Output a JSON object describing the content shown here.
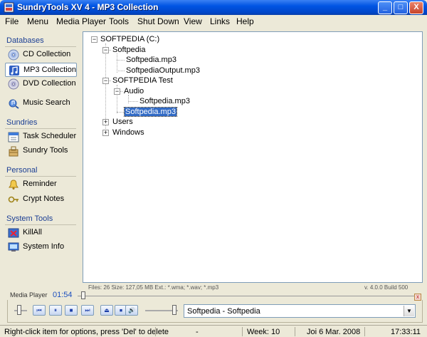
{
  "window": {
    "title": "SundryTools XV 4 - MP3 Collection",
    "minimize_symbol": "_",
    "maximize_symbol": "□",
    "close_symbol": "X"
  },
  "menu": [
    "File",
    "Menu",
    "Media Player",
    "Tools",
    "Shut Down",
    "View",
    "Links",
    "Help"
  ],
  "sidebar": {
    "databases": {
      "title": "Databases",
      "items": [
        {
          "label": "CD Collection",
          "icon": "cd-icon"
        },
        {
          "label": "MP3 Collection",
          "icon": "music-note-icon",
          "active": true
        },
        {
          "label": "DVD Collection",
          "icon": "dvd-icon"
        },
        {
          "label": "Music Search",
          "icon": "music-search-icon"
        }
      ]
    },
    "sundries": {
      "title": "Sundries",
      "items": [
        {
          "label": "Task Scheduler",
          "icon": "calendar-icon"
        },
        {
          "label": "Sundry Tools",
          "icon": "tools-icon"
        }
      ]
    },
    "personal": {
      "title": "Personal",
      "items": [
        {
          "label": "Reminder",
          "icon": "bell-icon"
        },
        {
          "label": "Crypt Notes",
          "icon": "key-icon"
        }
      ]
    },
    "system_tools": {
      "title": "System Tools",
      "items": [
        {
          "label": "KillAll",
          "icon": "killall-icon"
        },
        {
          "label": "System Info",
          "icon": "monitor-icon"
        }
      ]
    }
  },
  "tree": {
    "root": "SOFTPEDIA (C:)",
    "softpedia": "Softpedia",
    "softpedia_mp3": "Softpedia.mp3",
    "softpedia_output": "SoftpediaOutput.mp3",
    "softpedia_test": "SOFTPEDIA Test",
    "audio": "Audio",
    "audio_mp3": "Softpedia.mp3",
    "selected_mp3": "Softpedia.mp3",
    "users": "Users",
    "windows": "Windows",
    "expanded_symbol": "−",
    "collapsed_symbol": "+"
  },
  "info": {
    "files": "Files: 26 Size: 127,05 MB Ext.: *.wma; *.wav; *.mp3",
    "version": "v. 4.0.0 Build 500"
  },
  "player": {
    "label": "Media Player",
    "time": "01:54",
    "close_symbol": "x",
    "station": "Softpedia - Softpedia",
    "buttons": [
      "⏮",
      "⏸",
      "■",
      "⏭",
      "⏏",
      "⏹",
      "🔊"
    ]
  },
  "status": {
    "hint": "Right-click item for options, press 'Del' to delete",
    "dash": "-",
    "week": "Week: 10",
    "date": "Joi 6 Mar. 2008",
    "time": "17:33:11"
  },
  "colors": {
    "title_blue": "#0054e3",
    "selection": "#316ac5",
    "section_title": "#1c3f94",
    "player_time": "#1c4fbf"
  }
}
